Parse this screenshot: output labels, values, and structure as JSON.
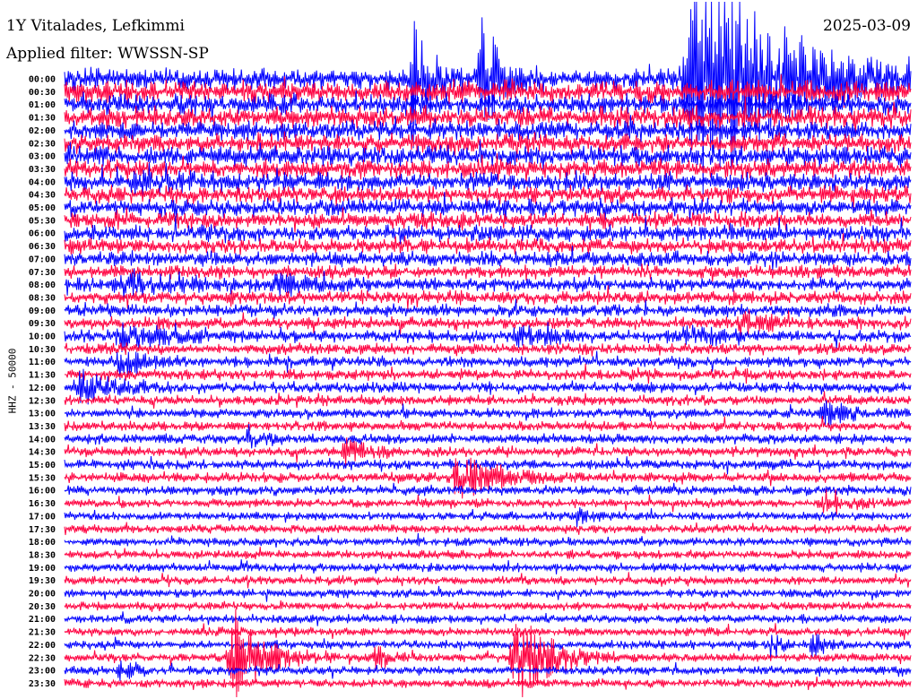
{
  "chart_data": {
    "type": "line",
    "title": "1Y Vitalades, Lefkimmi",
    "date": "2025-03-09",
    "filter_label": "Applied filter: WWSSN-SP",
    "ylabel": "HHZ - 50000",
    "rows": [
      "00:00",
      "00:30",
      "01:00",
      "01:30",
      "02:00",
      "02:30",
      "03:00",
      "03:30",
      "04:00",
      "04:30",
      "05:00",
      "05:30",
      "06:00",
      "06:30",
      "07:00",
      "07:30",
      "08:00",
      "08:30",
      "09:00",
      "09:30",
      "10:00",
      "10:30",
      "11:00",
      "11:30",
      "12:00",
      "12:30",
      "13:00",
      "13:30",
      "14:00",
      "14:30",
      "15:00",
      "15:30",
      "16:00",
      "16:30",
      "17:00",
      "17:30",
      "18:00",
      "18:30",
      "19:00",
      "19:30",
      "20:00",
      "20:30",
      "21:00",
      "21:30",
      "22:00",
      "22:30",
      "23:00",
      "23:30"
    ],
    "trace_colors": [
      "#0000ff",
      "#ff0040"
    ],
    "grid": false,
    "noise_profile": [
      9,
      9,
      8.5,
      8.5,
      8,
      8,
      8,
      7.5,
      7.5,
      7,
      7,
      6.5,
      6.5,
      6,
      6,
      5.5,
      5.5,
      5.5,
      5,
      5,
      5,
      4.5,
      4.5,
      4.5,
      4.5,
      4,
      4,
      4,
      4,
      4,
      4,
      4,
      4,
      3.5,
      3.5,
      3.5,
      3.5,
      3.5,
      3.5,
      3.5,
      3.5,
      3.5,
      3.5,
      3.5,
      3.5,
      3.5,
      3.5,
      3.5
    ],
    "events": [
      {
        "row": 0,
        "minute": 12.3,
        "amp": 70,
        "dur": 0.6
      },
      {
        "row": 0,
        "minute": 14.8,
        "amp": 60,
        "dur": 0.8
      },
      {
        "row": 0,
        "minute": 22.5,
        "amp": 120,
        "dur": 3.0
      },
      {
        "row": 8,
        "minute": 2.5,
        "amp": 12,
        "dur": 1.0
      },
      {
        "row": 16,
        "minute": 2.2,
        "amp": 10,
        "dur": 2.0
      },
      {
        "row": 16,
        "minute": 7.5,
        "amp": 8,
        "dur": 1.0
      },
      {
        "row": 19,
        "minute": 24,
        "amp": 10,
        "dur": 1.0
      },
      {
        "row": 20,
        "minute": 2,
        "amp": 12,
        "dur": 1.5
      },
      {
        "row": 20,
        "minute": 16,
        "amp": 9,
        "dur": 1.0
      },
      {
        "row": 20,
        "minute": 22,
        "amp": 9,
        "dur": 1.0
      },
      {
        "row": 20,
        "minute": 36,
        "amp": 10,
        "dur": 1.5
      },
      {
        "row": 21,
        "minute": 41,
        "amp": 10,
        "dur": 1.5
      },
      {
        "row": 22,
        "minute": 2,
        "amp": 12,
        "dur": 1.0
      },
      {
        "row": 24,
        "minute": 0.6,
        "amp": 14,
        "dur": 1.5
      },
      {
        "row": 26,
        "minute": 27,
        "amp": 12,
        "dur": 1.0
      },
      {
        "row": 28,
        "minute": 6.5,
        "amp": 9,
        "dur": 0.6
      },
      {
        "row": 28,
        "minute": 32,
        "amp": 9,
        "dur": 1.0
      },
      {
        "row": 29,
        "minute": 10,
        "amp": 12,
        "dur": 1.0
      },
      {
        "row": 30,
        "minute": 40,
        "amp": 18,
        "dur": 1.2
      },
      {
        "row": 31,
        "minute": 14,
        "amp": 22,
        "dur": 1.5
      },
      {
        "row": 33,
        "minute": 27,
        "amp": 10,
        "dur": 1.0
      },
      {
        "row": 33,
        "minute": 30.5,
        "amp": 12,
        "dur": 1.2
      },
      {
        "row": 34,
        "minute": 18,
        "amp": 8,
        "dur": 0.8
      },
      {
        "row": 38,
        "minute": 47.5,
        "amp": 14,
        "dur": 0.8
      },
      {
        "row": 42,
        "minute": 40.5,
        "amp": 12,
        "dur": 0.8
      },
      {
        "row": 44,
        "minute": 25,
        "amp": 14,
        "dur": 0.5
      },
      {
        "row": 44,
        "minute": 26.5,
        "amp": 12,
        "dur": 0.5
      },
      {
        "row": 45,
        "minute": 6,
        "amp": 48,
        "dur": 1.2
      },
      {
        "row": 45,
        "minute": 11,
        "amp": 16,
        "dur": 0.5
      },
      {
        "row": 45,
        "minute": 16,
        "amp": 48,
        "dur": 1.2
      },
      {
        "row": 46,
        "minute": 2,
        "amp": 10,
        "dur": 0.6
      }
    ]
  }
}
